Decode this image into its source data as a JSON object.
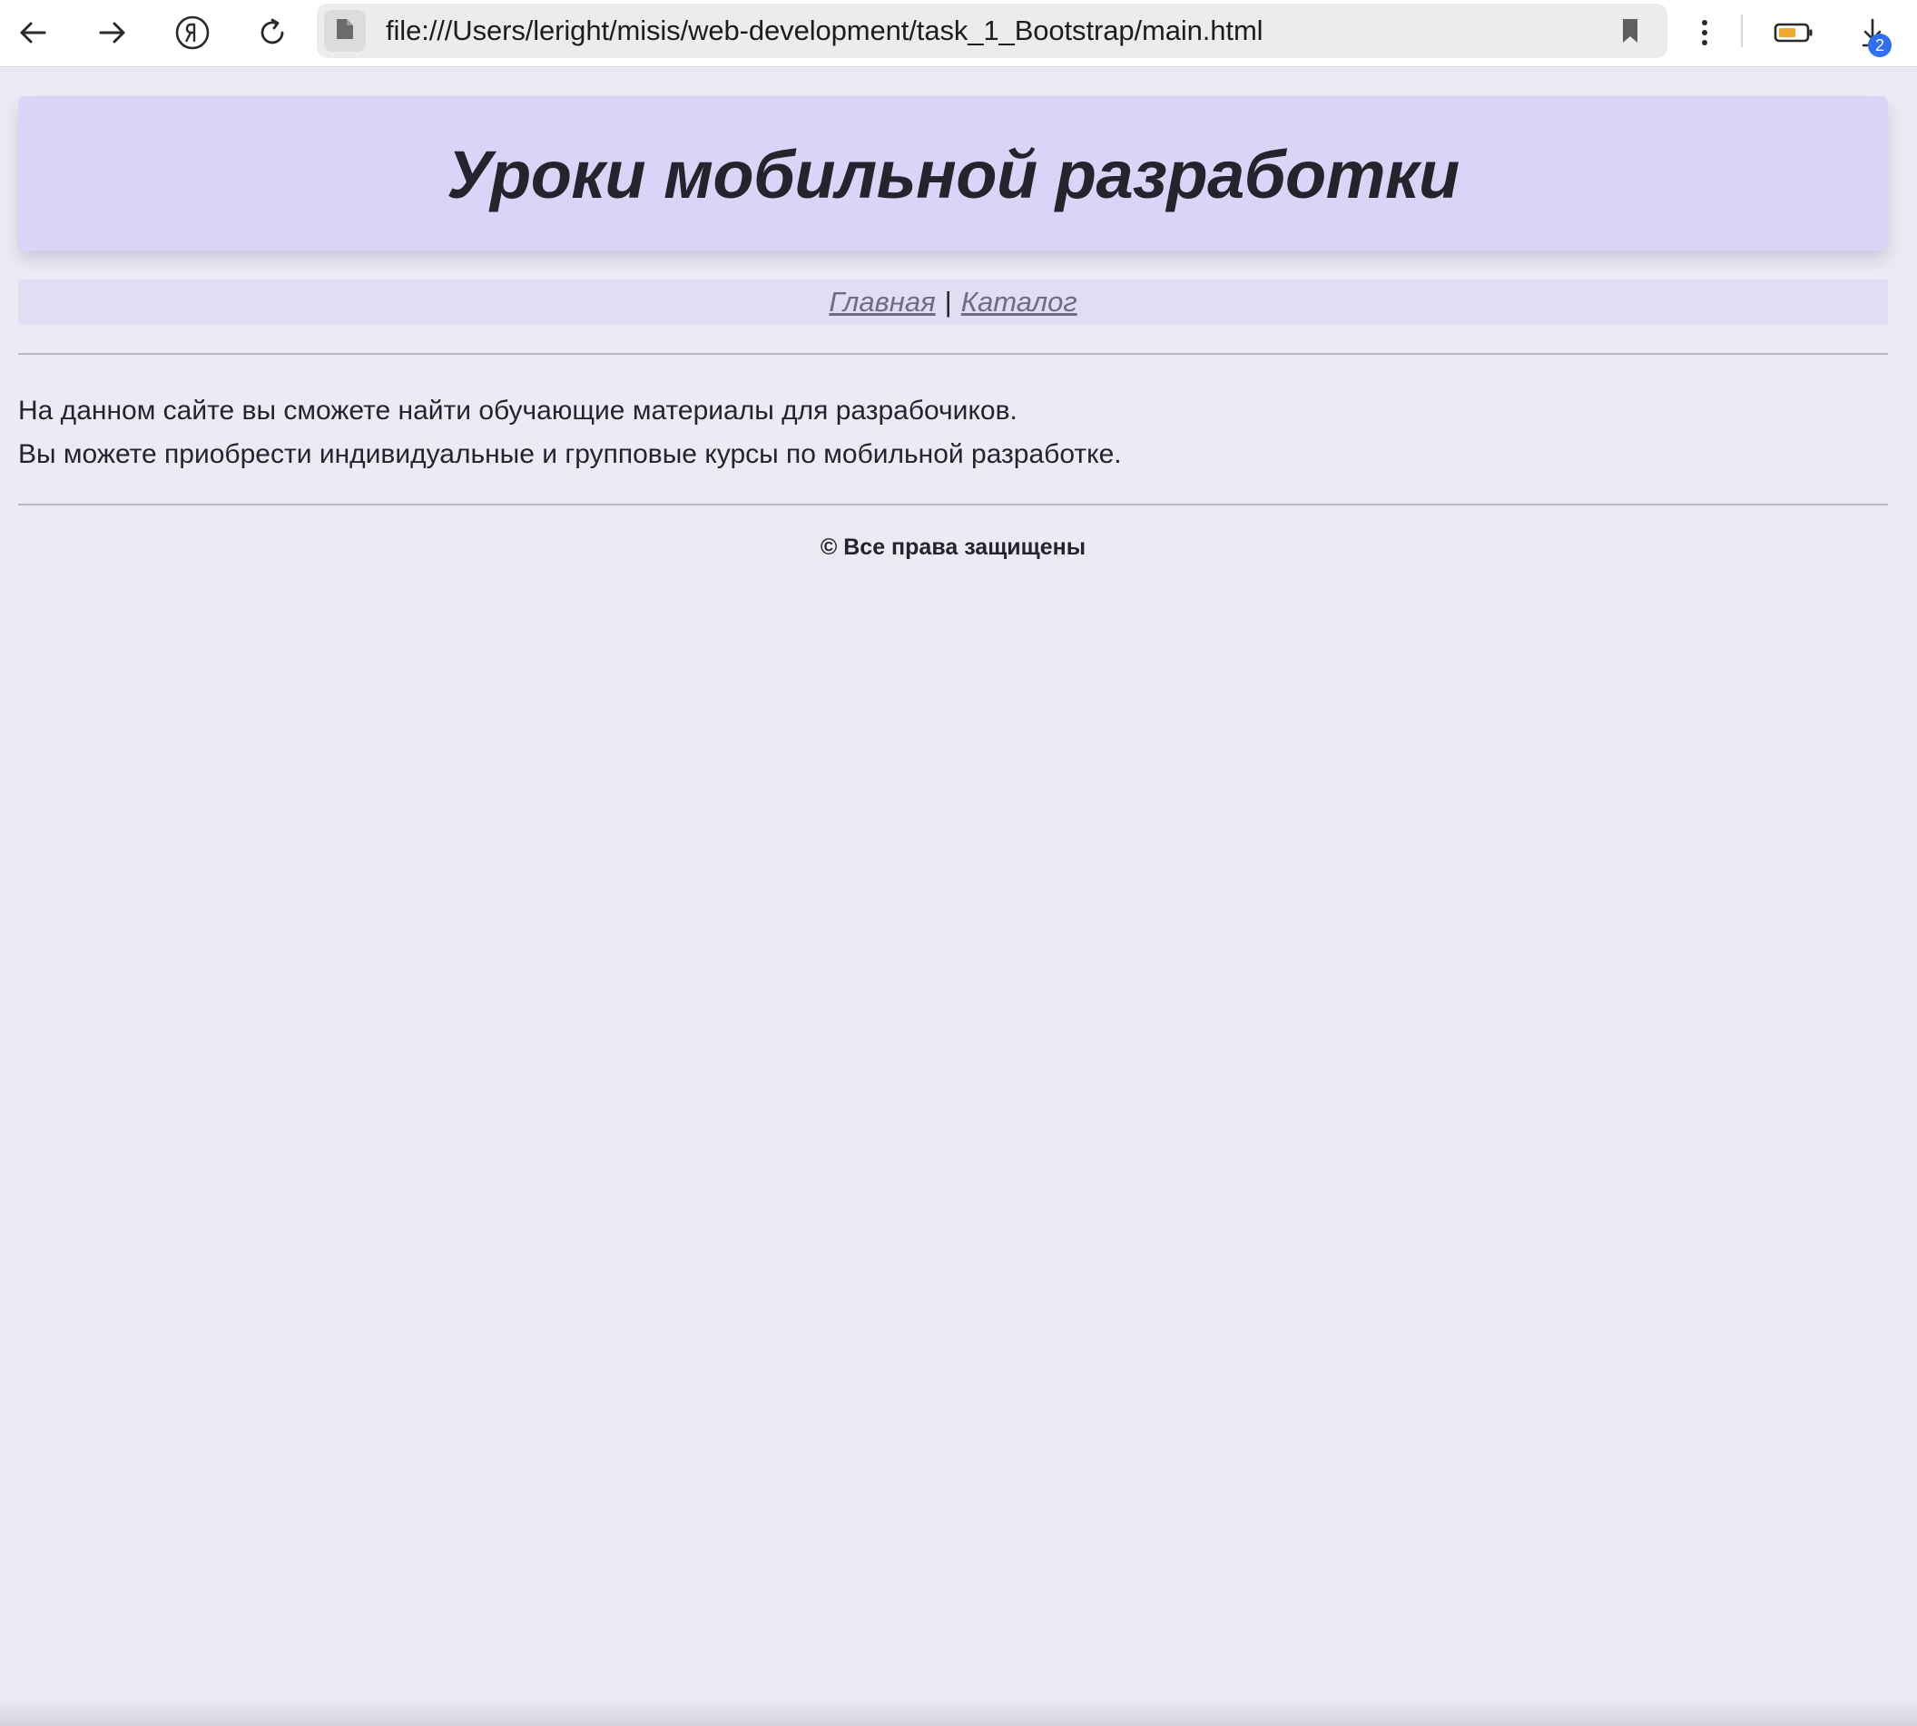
{
  "browser": {
    "url": "file:///Users/leright/misis/web-development/task_1_Bootstrap/main.html",
    "downloads_count": "2",
    "icons": {
      "back": "arrow-left-icon",
      "forward": "arrow-right-icon",
      "yandex": "yandex-logo-icon",
      "reload": "reload-icon",
      "page_type": "file-icon",
      "bookmark": "bookmark-icon",
      "menu": "kebab-menu-icon",
      "battery": "battery-icon",
      "downloads": "download-icon"
    },
    "colors": {
      "toolbar_bg": "#ffffff",
      "addressbar_bg": "#ececec",
      "badge": "#2f6ff1",
      "battery_fill": "#f0a92e"
    }
  },
  "page": {
    "title": "Уроки мобильной разработки",
    "nav": {
      "home_label": "Главная",
      "separator": "|",
      "catalog_label": "Каталог"
    },
    "content": {
      "line1": "На данном сайте вы сможете найти обучающие материалы для разрабочиков.",
      "line2": "Вы можете приобрести индивидуальные и групповые курсы по мобильной разработке."
    },
    "footer": "© Все права защищены",
    "colors": {
      "background": "#ecebf5",
      "header_bg": "#dcd4f8",
      "nav_bg": "#e0def3",
      "link": "#6e6d80"
    }
  }
}
